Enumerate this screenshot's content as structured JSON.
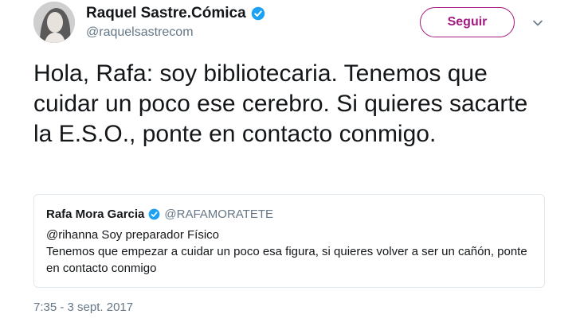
{
  "author": {
    "display_name": "Raquel Sastre.Cómica",
    "handle": "@raquelsastrecom",
    "avatar_icon": "profile-photo"
  },
  "follow_button": {
    "label": "Seguir",
    "color": "#a3197f"
  },
  "menu_icon": "chevron-down-icon",
  "tweet": {
    "text": "Hola, Rafa: soy bibliotecaria. Tenemos que cuidar un poco ese cerebro. Si quieres sacarte la E.S.O., ponte en contacto conmigo.",
    "timestamp": "7:35 - 3 sept. 2017"
  },
  "quoted_tweet": {
    "display_name": "Rafa Mora Garcia",
    "handle": "@RAFAMORATETE",
    "text_line1": "@rihanna Soy preparador Físico",
    "text_line2": "Tenemos que empezar a cuidar un poco esa figura, si quieres volver a ser un cañón, ponte en contacto conmigo"
  },
  "colors": {
    "verified_badge": "#1da1f2",
    "secondary_text": "#657786",
    "border": "#e1e8ed"
  }
}
